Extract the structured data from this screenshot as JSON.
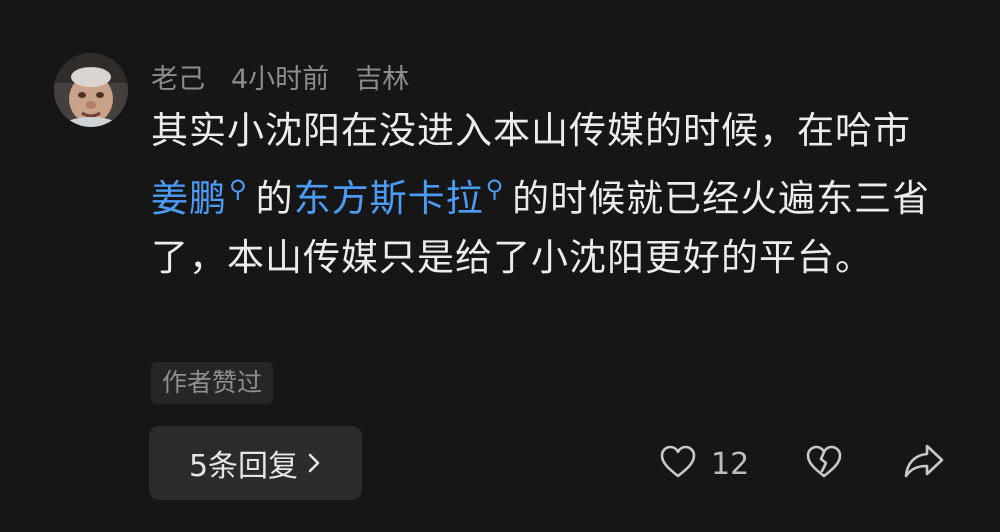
{
  "comment": {
    "username": "老己",
    "time": "4小时前",
    "location": "吉林",
    "text_part1": "其实小沈阳在没进入本山传媒的时候，在哈市",
    "link1": "姜鹏",
    "text_part2": "的",
    "link2": "东方斯卡拉",
    "text_part3": "的时候就已经火遍东三省了，本山传媒只是给了小沈阳更好的平台。",
    "badge": "作者赞过"
  },
  "actions": {
    "replies_label": "5条回复",
    "like_count": "12"
  },
  "icons": {
    "avatar": "avatar-image",
    "search_link": "search-icon",
    "chevron": "chevron-right-icon",
    "like": "heart-icon",
    "dislike": "broken-heart-icon",
    "share": "share-arrow-icon"
  },
  "colors": {
    "background": "#161616",
    "link": "#4c9bf5",
    "meta_text": "#8d8d8d",
    "button_bg": "#2b2b2b"
  }
}
